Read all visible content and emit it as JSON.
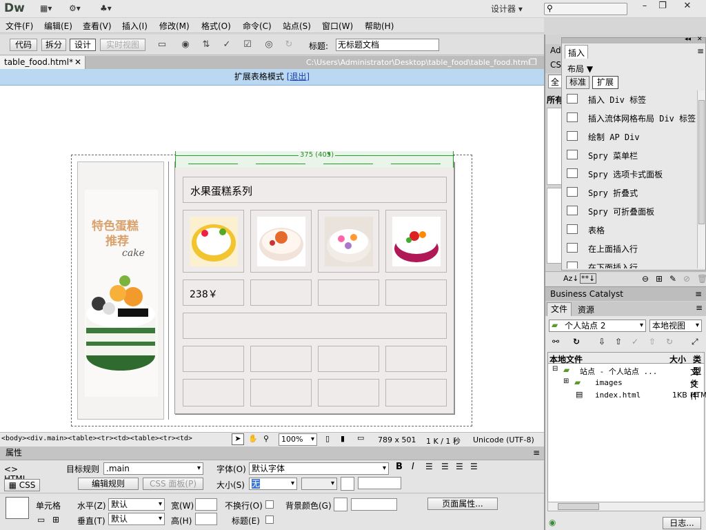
{
  "app": {
    "logo": "Dw",
    "workspace": "设计器"
  },
  "menu": [
    "文件(F)",
    "编辑(E)",
    "查看(V)",
    "插入(I)",
    "修改(M)",
    "格式(O)",
    "命令(C)",
    "站点(S)",
    "窗口(W)",
    "帮助(H)"
  ],
  "viewbar": {
    "code": "代码",
    "split": "拆分",
    "design": "设计",
    "live": "实时视图",
    "title_label": "标题:",
    "title_value": "无标题文档"
  },
  "doc": {
    "tab": "table_food.html*",
    "path": "C:\\Users\\Administrator\\Desktop\\table_food\\table_food.html",
    "expanded_mode": "扩展表格模式",
    "exit": "[退出]"
  },
  "canvas": {
    "width_label": "375 (405)",
    "sidebar_title_1": "特色蛋糕",
    "sidebar_title_2": "推荐",
    "sidebar_sub": "cake",
    "heading": "水果蛋糕系列",
    "price": "238￥"
  },
  "status": {
    "tags": "<body><div.main><table><tr><td><table><tr><td>",
    "zoom": "100%",
    "size": "789 x 501",
    "speed": "1 K / 1 秒",
    "encoding": "Unicode (UTF-8)"
  },
  "props": {
    "header": "属性",
    "html": "HTML",
    "css": "CSS",
    "target_rule_label": "目标规则",
    "target_rule": ".main",
    "edit_rule": "编辑规则",
    "css_panel": "CSS 面板(P)",
    "font_label": "字体(O)",
    "font": "默认字体",
    "size_label": "大小(S)",
    "size": "无",
    "cell_label": "单元格",
    "h_label": "水平(Z)",
    "h_value": "默认",
    "v_label": "垂直(T)",
    "v_value": "默认",
    "w_label": "宽(W)",
    "h2_label": "高(H)",
    "nowrap_label": "不换行(O)",
    "header_label": "标题(E)",
    "bg_label": "背景颜色(G)",
    "page_props": "页面属性..."
  },
  "insert": {
    "tab_adobe": "Ad",
    "tab_css": "CS",
    "tab_all": "全",
    "all_label": "所有",
    "title": "插入",
    "category": "布局",
    "std": "标准",
    "ext": "扩展",
    "items": [
      "插入 Div 标签",
      "插入流体网格布局 Div 标签",
      "绘制 AP Div",
      "Spry 菜单栏",
      "Spry 选项卡式面板",
      "Spry 折叠式",
      "Spry 可折叠面板",
      "表格",
      "在上面插入行",
      "在下面插入行"
    ]
  },
  "bc": "Business Catalyst",
  "files": {
    "tab_files": "文件",
    "tab_assets": "资源",
    "site": "个人站点 2",
    "view": "本地视图",
    "col_local": "本地文件",
    "col_size": "大小",
    "col_type": "类型",
    "rows": [
      {
        "name": "站点 - 个人站点 ...",
        "size": "",
        "type": "文件"
      },
      {
        "name": "images",
        "size": "",
        "type": "文件"
      },
      {
        "name": "index.html",
        "size": "1KB",
        "type": "HTM"
      }
    ],
    "log": "日志..."
  }
}
